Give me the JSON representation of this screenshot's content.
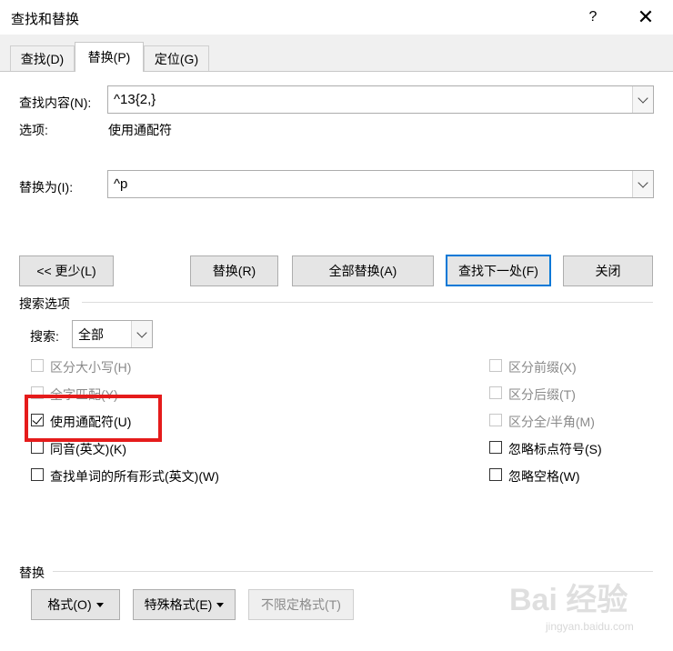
{
  "window": {
    "title": "查找和替换",
    "help_label": "?",
    "close_label": "✕"
  },
  "tabs": [
    {
      "label": "查找(D)",
      "active": false
    },
    {
      "label": "替换(P)",
      "active": true
    },
    {
      "label": "定位(G)",
      "active": false
    }
  ],
  "find": {
    "label": "查找内容(N):",
    "value": "^13{2,}"
  },
  "options": {
    "label": "选项:",
    "value": "使用通配符"
  },
  "replace": {
    "label": "替换为(I):",
    "value": "^p"
  },
  "buttons": {
    "less": "<< 更少(L)",
    "replace": "替换(R)",
    "replace_all": "全部替换(A)",
    "find_next": "查找下一处(F)",
    "close": "关闭"
  },
  "search_options": {
    "header": "搜索选项",
    "search_label": "搜索:",
    "search_value": "全部",
    "left_checks": [
      {
        "label": "区分大小写(H)",
        "checked": false,
        "disabled": true
      },
      {
        "label": "全字匹配(Y)",
        "checked": false,
        "disabled": true
      },
      {
        "label": "使用通配符(U)",
        "checked": true,
        "disabled": false
      },
      {
        "label": "同音(英文)(K)",
        "checked": false,
        "disabled": false
      },
      {
        "label": "查找单词的所有形式(英文)(W)",
        "checked": false,
        "disabled": false
      }
    ],
    "right_checks": [
      {
        "label": "区分前缀(X)",
        "checked": false,
        "disabled": true
      },
      {
        "label": "区分后缀(T)",
        "checked": false,
        "disabled": true
      },
      {
        "label": "区分全/半角(M)",
        "checked": false,
        "disabled": true
      },
      {
        "label": "忽略标点符号(S)",
        "checked": false,
        "disabled": false
      },
      {
        "label": "忽略空格(W)",
        "checked": false,
        "disabled": false
      }
    ]
  },
  "replace_section": {
    "header": "替换",
    "format": "格式(O)",
    "special": "特殊格式(E)",
    "no_format": "不限定格式(T)"
  },
  "watermark": {
    "main": "Bai 经验",
    "sub": "jingyan.baidu.com"
  },
  "colors": {
    "accent": "#0078d7",
    "highlight": "#e51b1b"
  }
}
